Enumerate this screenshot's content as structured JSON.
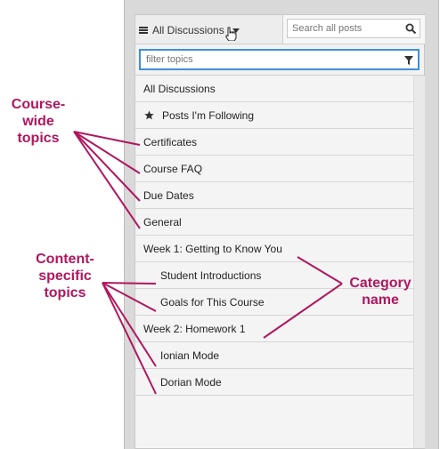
{
  "header": {
    "menu_label": "All Discussions",
    "search_placeholder": "Search all posts"
  },
  "filter": {
    "placeholder": "filter topics"
  },
  "topics": [
    {
      "label": "All Discussions",
      "indent": 0
    },
    {
      "label": "Posts I'm Following",
      "indent": 0,
      "icon": "star-icon"
    },
    {
      "label": "Certificates",
      "indent": 0
    },
    {
      "label": "Course FAQ",
      "indent": 0
    },
    {
      "label": "Due Dates",
      "indent": 0
    },
    {
      "label": "General",
      "indent": 0
    },
    {
      "label": "Week 1: Getting to Know You",
      "indent": 0
    },
    {
      "label": "Student Introductions",
      "indent": 1
    },
    {
      "label": "Goals for This Course",
      "indent": 1
    },
    {
      "label": "Week 2: Homework 1",
      "indent": 0
    },
    {
      "label": "Ionian Mode",
      "indent": 1
    },
    {
      "label": "Dorian Mode",
      "indent": 1
    }
  ],
  "annotations": {
    "course_wide": [
      "Course-",
      "wide",
      "topics"
    ],
    "content_specific": [
      "Content-",
      "specific",
      "topics"
    ],
    "category": [
      "Category",
      "name"
    ]
  },
  "colors": {
    "annotation": "#b0175d",
    "focus_border": "#3f8fd3"
  }
}
